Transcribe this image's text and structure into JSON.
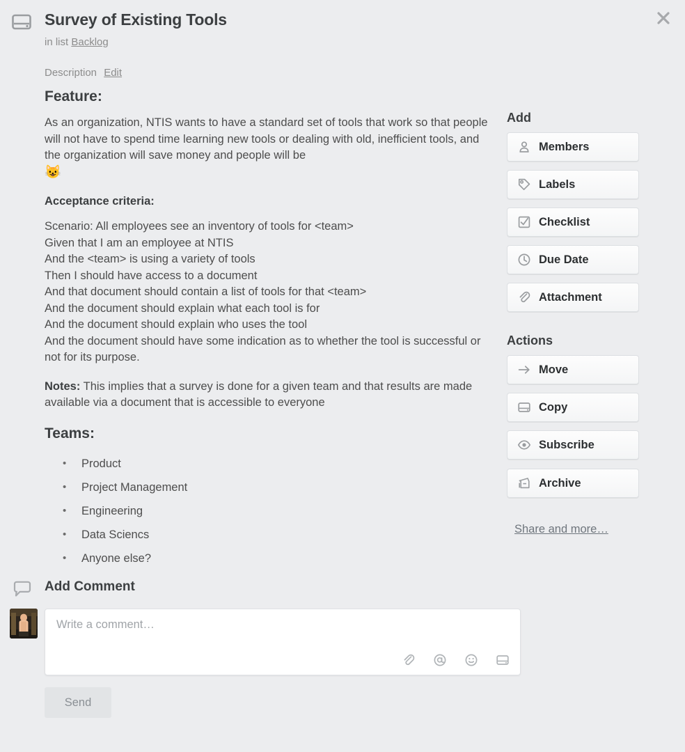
{
  "colors": {
    "page_background": "#ECEDEF",
    "text_primary": "#3C3F41",
    "text_body": "#4D4D4D",
    "text_muted": "#8C8C8C",
    "button_face": "#FAFBFB",
    "button_border": "#DCDFE2",
    "send_button_bg": "#E2E4E6"
  },
  "header": {
    "card_icon": "card-icon",
    "title": "Survey of Existing Tools",
    "subtitle_prefix": "in list",
    "list_name": "Backlog",
    "close_icon": "close-icon"
  },
  "description": {
    "label": "Description",
    "edit_label": "Edit",
    "feature_heading": "Feature:",
    "feature_paragraph": "As an organization, NTIS wants to have a standard set of tools that work so that people will not have to spend time learning new tools or dealing with old, inefficient tools, and the organization will save money and people will be",
    "feature_emoji": "😺",
    "acceptance_label": "Acceptance criteria:",
    "acceptance_lines": [
      "Scenario: All employees see an inventory of tools for <team>",
      "Given that I am an employee at NTIS",
      "And the <team> is using a variety of tools",
      "Then I should have access to a document",
      "And that document should contain a list of tools for that <team>",
      "And the document should explain what each tool is for",
      "And the document should explain who uses the tool",
      "And the document should have some indication as to whether the tool is successful or not for its purpose."
    ],
    "notes_label": "Notes:",
    "notes_text": "This implies that a survey is done for a given team and that results are made available via a document that is accessible to everyone",
    "teams_heading": "Teams:",
    "teams": [
      "Product",
      "Project Management",
      "Engineering",
      "Data Sciencs",
      "Anyone else?"
    ]
  },
  "sidebar": {
    "add_heading": "Add",
    "add_buttons": [
      {
        "label": "Members",
        "icon": "person-icon"
      },
      {
        "label": "Labels",
        "icon": "tag-icon"
      },
      {
        "label": "Checklist",
        "icon": "checkbox-checked-icon"
      },
      {
        "label": "Due Date",
        "icon": "clock-icon"
      },
      {
        "label": "Attachment",
        "icon": "paperclip-icon"
      }
    ],
    "actions_heading": "Actions",
    "action_buttons": [
      {
        "label": "Move",
        "icon": "arrow-right-icon"
      },
      {
        "label": "Copy",
        "icon": "card-icon"
      },
      {
        "label": "Subscribe",
        "icon": "eye-icon"
      },
      {
        "label": "Archive",
        "icon": "archive-icon"
      }
    ],
    "share_link": "Share and more…"
  },
  "comment": {
    "section_icon": "comment-bubble-icon",
    "section_title": "Add Comment",
    "avatar": "user-avatar",
    "placeholder": "Write a comment…",
    "value": "",
    "tools": [
      {
        "name": "paperclip-icon"
      },
      {
        "name": "mention-icon"
      },
      {
        "name": "emoji-icon"
      },
      {
        "name": "attach-card-icon"
      }
    ],
    "send_label": "Send"
  }
}
